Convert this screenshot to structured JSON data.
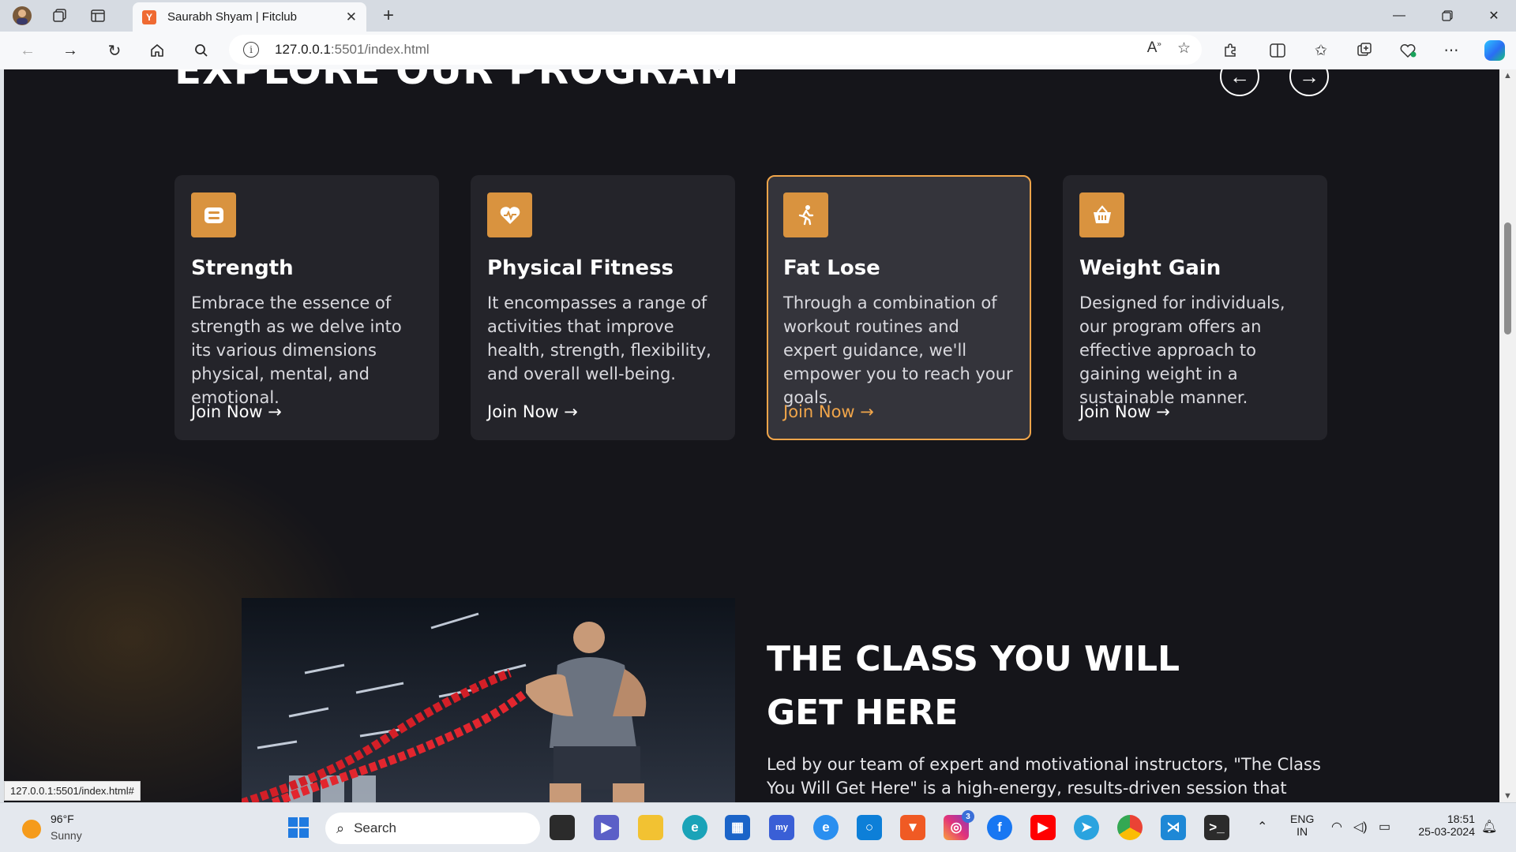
{
  "browser": {
    "tab_title": "Saurabh Shyam | Fitclub",
    "tab_favicon_letter": "Y",
    "url_host": "127.0.0.1",
    "url_path": ":5501/index.html",
    "status_url": "127.0.0.1:5501/index.html#"
  },
  "program": {
    "section_title": "EXPLORE OUR PROGRAM",
    "prev_arrow": "←",
    "next_arrow": "→",
    "cards": [
      {
        "title": "Strength",
        "description": "Embrace the essence of strength as we delve into its various dimensions physical, mental, and emotional.",
        "link": "Join Now →",
        "icon": "dumbbell-icon"
      },
      {
        "title": "Physical Fitness",
        "description": "It encompasses a range of activities that improve health, strength, flexibility, and overall well-being.",
        "link": "Join Now →",
        "icon": "heart-pulse-icon"
      },
      {
        "title": "Fat Lose",
        "description": "Through a combination of workout routines and expert guidance, we'll empower you to reach your goals.",
        "link": "Join Now →",
        "icon": "running-icon"
      },
      {
        "title": "Weight Gain",
        "description": "Designed for individuals, our program offers an effective approach to gaining weight in a sustainable manner.",
        "link": "Join Now →",
        "icon": "basket-icon"
      }
    ]
  },
  "class_section": {
    "heading_line1": "THE CLASS YOU WILL",
    "heading_line2": "GET HERE",
    "description": "Led by our team of expert and motivational instructors, \"The Class You Will Get Here\" is a high-energy, results-driven session that combines a"
  },
  "taskbar": {
    "weather_temp": "96°F",
    "weather_condition": "Sunny",
    "search_label": "Search",
    "lang_line1": "ENG",
    "lang_line2": "IN",
    "time": "18:51",
    "date": "25-03-2024",
    "instagram_badge": "3"
  },
  "colors": {
    "accent": "#d9933f",
    "page_bg": "#15151a",
    "card_bg": "#24242a",
    "active_border": "#f0a54a"
  }
}
